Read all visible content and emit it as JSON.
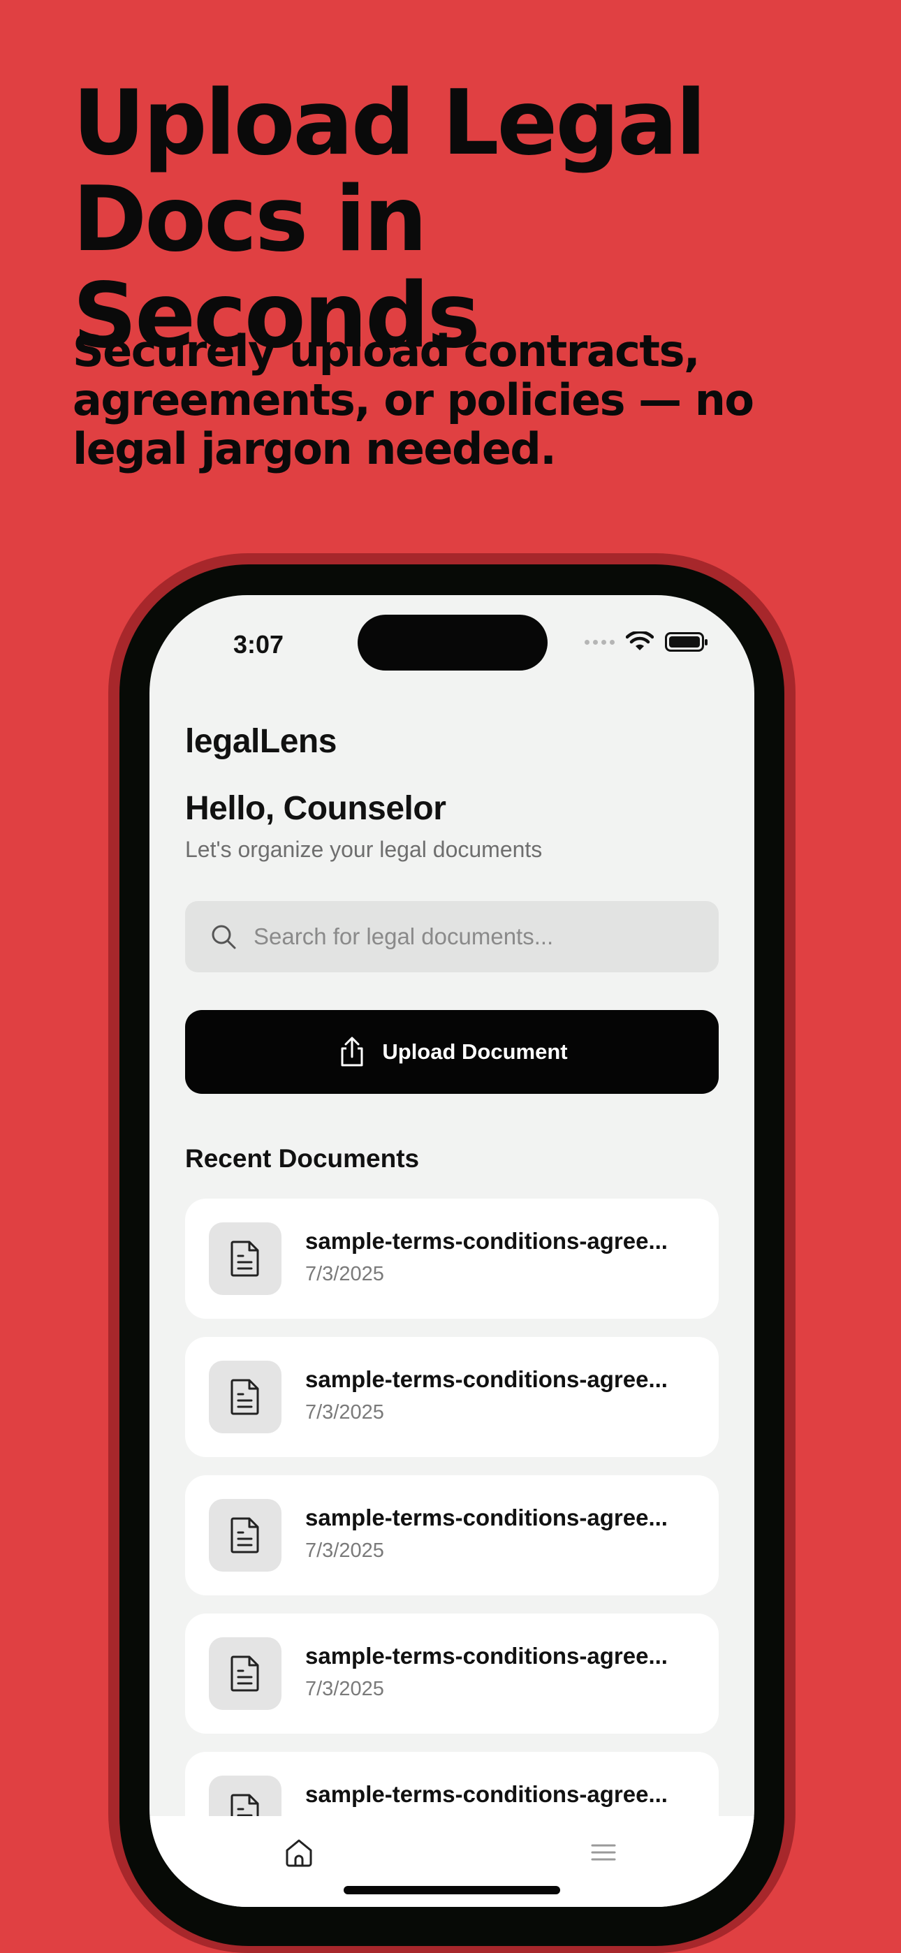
{
  "promo": {
    "headline_line1": "Upload Legal",
    "headline_line2": "Docs in Seconds",
    "sub_line1": "Securely upload contracts,",
    "sub_line2": "agreements, or policies — no",
    "sub_line3": "legal jargon needed."
  },
  "status_bar": {
    "time": "3:07"
  },
  "app": {
    "name": "legalLens",
    "greeting": "Hello, Counselor",
    "greeting_sub": "Let's organize your legal documents",
    "search_placeholder": "Search for legal documents...",
    "upload_label": "Upload Document",
    "recent_title": "Recent Documents"
  },
  "documents": [
    {
      "name": "sample-terms-conditions-agree...",
      "date": "7/3/2025"
    },
    {
      "name": "sample-terms-conditions-agree...",
      "date": "7/3/2025"
    },
    {
      "name": "sample-terms-conditions-agree...",
      "date": "7/3/2025"
    },
    {
      "name": "sample-terms-conditions-agree...",
      "date": "7/3/2025"
    },
    {
      "name": "sample-terms-conditions-agree...",
      "date": ""
    }
  ],
  "colors": {
    "background": "#E04042",
    "phone_frame": "#070a06",
    "screen": "#F2F3F2",
    "button": "#050505"
  },
  "icons": {
    "search": "search-icon",
    "upload": "upload-icon",
    "document": "document-icon",
    "home": "home-icon",
    "menu": "menu-icon",
    "wifi": "wifi-icon",
    "battery": "battery-icon"
  }
}
